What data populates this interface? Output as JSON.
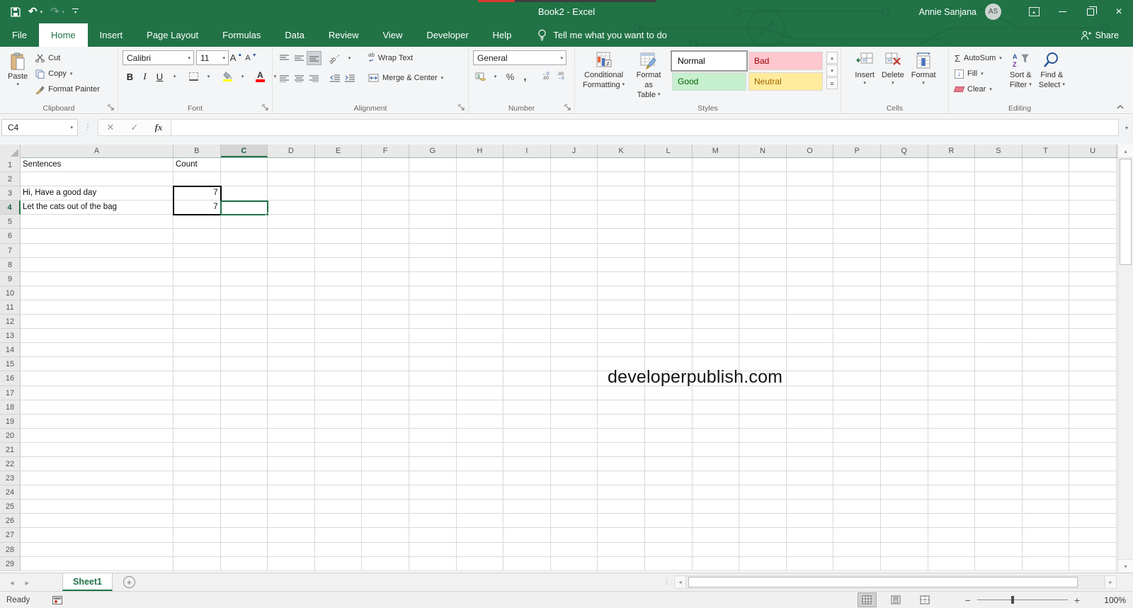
{
  "colors": {
    "excel_green": "#217346",
    "gridline": "#d9d9d9",
    "bad_bg": "#ffc7ce",
    "bad_fg": "#9c0006",
    "good_bg": "#c6efce",
    "good_fg": "#006100",
    "neutral_bg": "#ffeb9c",
    "neutral_fg": "#9c6500",
    "fill_accent": "#ffff00",
    "font_color_accent": "#ff0000"
  },
  "icons": {
    "dropdown": "▾",
    "undo": "↶",
    "redo": "↷",
    "cross": "✕",
    "check": "✓",
    "dots_v": "⋮",
    "nav_left": "◂",
    "nav_right": "▸",
    "up": "▴",
    "down": "▾",
    "plus": "+",
    "minus": "−",
    "percent": "%",
    "comma": ",",
    "sigma": "Σ",
    "fill_arrow": "↓",
    "wrap_ab": "ab",
    "wrap_return": "↵",
    "more": "≡",
    "sort_a": "A",
    "sort_z": "Z",
    "collapse": "⌃"
  },
  "titlebar": {
    "title": "Book2  -  Excel",
    "user": "Annie Sanjana",
    "avatar": "AS"
  },
  "tabs": {
    "items": [
      "File",
      "Home",
      "Insert",
      "Page Layout",
      "Formulas",
      "Data",
      "Review",
      "View",
      "Developer",
      "Help"
    ],
    "active": "Home",
    "tell_me": "Tell me what you want to do",
    "share": "Share"
  },
  "ribbon": {
    "clipboard": {
      "label": "Clipboard",
      "paste": "Paste",
      "cut": "Cut",
      "copy": "Copy",
      "format_painter": "Format Painter"
    },
    "font": {
      "label": "Font",
      "name": "Calibri",
      "size": "11",
      "bold": "B",
      "italic": "I",
      "underline": "U"
    },
    "alignment": {
      "label": "Alignment",
      "wrap": "Wrap Text",
      "merge": "Merge & Center"
    },
    "number": {
      "label": "Number",
      "format": "General"
    },
    "styles": {
      "label": "Styles",
      "cf1": "Conditional",
      "cf2": "Formatting",
      "ft1": "Format as",
      "ft2": "Table",
      "gallery": [
        {
          "name": "Normal",
          "bg": "#ffffff",
          "fg": "#000000",
          "selected": true
        },
        {
          "name": "Bad",
          "bg": "#ffc7ce",
          "fg": "#9c0006",
          "selected": false
        },
        {
          "name": "Good",
          "bg": "#c6efce",
          "fg": "#006100",
          "selected": false
        },
        {
          "name": "Neutral",
          "bg": "#ffeb9c",
          "fg": "#9c6500",
          "selected": false
        }
      ]
    },
    "cells": {
      "label": "Cells",
      "insert": "Insert",
      "delete": "Delete",
      "format": "Format"
    },
    "editing": {
      "label": "Editing",
      "autosum": "AutoSum",
      "fill": "Fill",
      "clear": "Clear",
      "sort1": "Sort &",
      "sort2": "Filter",
      "find1": "Find &",
      "find2": "Select"
    }
  },
  "formula_bar": {
    "name_box": "C4",
    "fx": "fx",
    "value": ""
  },
  "grid": {
    "columns": [
      "A",
      "B",
      "C",
      "D",
      "E",
      "F",
      "G",
      "H",
      "I",
      "J",
      "K",
      "L",
      "M",
      "N",
      "O",
      "P",
      "Q",
      "R",
      "S",
      "T",
      "U"
    ],
    "row_count": 29,
    "cells": {
      "A1": "Sentences",
      "B1": "Count",
      "A3": "Hi, Have a good day",
      "B3": "7",
      "A4": "Let the cats out of the bag",
      "B4": "7"
    },
    "selected_column": "C",
    "selected_row": 4,
    "active_cell": "C4",
    "bordered_range": "B3:B4",
    "watermark": "developerpublish.com"
  },
  "sheetbar": {
    "active_tab": "Sheet1"
  },
  "statusbar": {
    "mode": "Ready",
    "zoom_level": "100%"
  }
}
